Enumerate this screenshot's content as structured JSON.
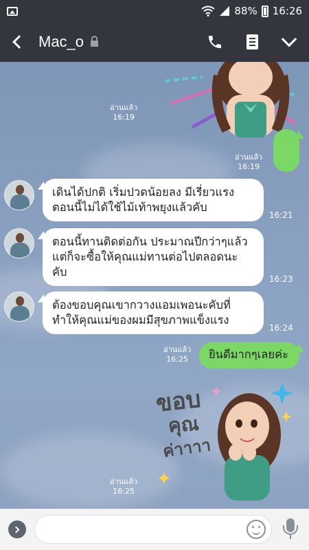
{
  "status_bar": {
    "battery": "88%",
    "time": "16:26"
  },
  "header": {
    "title": "Mac_o"
  },
  "messages": [
    {
      "read": "อ่านแล้ว",
      "time": "16:19"
    },
    {
      "read": "อ่านแล้ว",
      "time": "16:19"
    },
    {
      "text": "เดินได้ปกติ เริ่มปวดน้อยลง มีเรี่ยวแรง\nตอนนี้ไม่ได้ใช้ไม้เท้าพยุงแล้วคับ",
      "time": "16:21"
    },
    {
      "text": "ตอนนี้ทานติดต่อกัน ประมาณปีกว่าๆแล้ว\nแต่ก็จะซื้อให้คุณแม่ทานต่อไปตลอดนะ\nคับ",
      "time": "16:23"
    },
    {
      "text": "ต้องขอบคุณเขากวางแอมเพอนะคับที่\nทำให้คุณแม่ของผมมีสุขภาพแข็งแรง",
      "time": "16:24"
    },
    {
      "read": "อ่านแล้ว",
      "time": "16:25",
      "text": "ยินดีมากๆเลยค่ะ"
    },
    {
      "read": "อ่านแล้ว",
      "time": "16:25"
    }
  ],
  "sticker_text": [
    "ขอบ",
    "คุณ",
    "ค่าาาา"
  ],
  "colors": {
    "header_bg": "#33363f",
    "outgoing_bubble": "#7bd766",
    "incoming_bubble": "#ffffff",
    "chat_bg": "#8aa0c0"
  },
  "input": {
    "placeholder": ""
  }
}
